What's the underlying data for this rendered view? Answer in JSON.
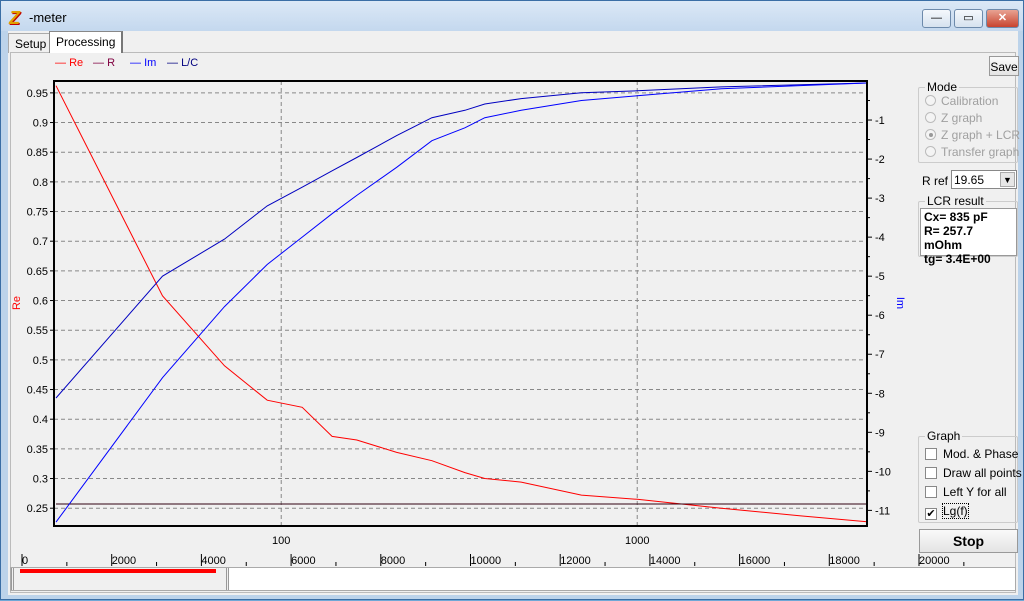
{
  "window": {
    "title": "-meter",
    "logo": "Z",
    "minimize": "—",
    "maximize": "▭",
    "close": "✕"
  },
  "tabs": [
    {
      "label": "Setup"
    },
    {
      "label": "Processing"
    }
  ],
  "legend": [
    {
      "label": "Re",
      "color": "#ff0000"
    },
    {
      "label": "R",
      "color": "#800040"
    },
    {
      "label": "Im",
      "color": "#0000ff"
    },
    {
      "label": "L/C",
      "color": "#000080"
    }
  ],
  "save_label": "Save",
  "mode": {
    "title": "Mode",
    "options": [
      {
        "label": "Calibration",
        "selected": false
      },
      {
        "label": "Z graph",
        "selected": false
      },
      {
        "label": "Z graph + LCR",
        "selected": true
      },
      {
        "label": "Transfer graph",
        "selected": false
      }
    ]
  },
  "rref": {
    "label": "R ref",
    "value": "19.65"
  },
  "lcr": {
    "title": "LCR result",
    "lines": [
      "Cx= 835 pF",
      "R= 257.7 mOhm",
      "tg= 3.4E+00"
    ]
  },
  "graph": {
    "title": "Graph",
    "options": [
      {
        "label": "Mod. & Phase",
        "checked": false
      },
      {
        "label": "Draw all points",
        "checked": false
      },
      {
        "label": "Left Y for all",
        "checked": false
      },
      {
        "label": "Lg(f)",
        "checked": true
      }
    ]
  },
  "stop_label": "Stop",
  "ruler": {
    "ticks": [
      "0",
      "2000",
      "4000",
      "6000",
      "8000",
      "10000",
      "12000",
      "14000",
      "16000",
      "18000",
      "20000"
    ],
    "range_selected": [
      0,
      4300
    ]
  },
  "chart_data": {
    "type": "line",
    "xscale": "log",
    "xlim": [
      23,
      4420
    ],
    "x_ticks": [
      "100",
      "1000"
    ],
    "x_tick_values": [
      100,
      1000
    ],
    "ylabel": "Re",
    "ylim": [
      0.22,
      0.97
    ],
    "y_ticks": [
      "0.95",
      "0.9",
      "0.85",
      "0.8",
      "0.75",
      "0.7",
      "0.65",
      "0.6",
      "0.55",
      "0.5",
      "0.45",
      "0.4",
      "0.35",
      "0.3",
      "0.25"
    ],
    "y2label": "Im",
    "y2lim": [
      -11.4,
      0
    ],
    "y2_ticks": [
      "-1",
      "-2",
      "-3",
      "-4",
      "-5",
      "-6",
      "-7",
      "-8",
      "-9",
      "-10",
      "-11"
    ],
    "grid": true,
    "series": [
      {
        "name": "Re",
        "axis": "left",
        "color": "#ff0000",
        "x": [
          23.3,
          46.4,
          69.3,
          91.3,
          114.5,
          139,
          163,
          211,
          265,
          328,
          373,
          472,
          697,
          1000,
          1722,
          2880,
          4420
        ],
        "y": [
          0.962,
          0.608,
          0.49,
          0.432,
          0.42,
          0.371,
          0.365,
          0.344,
          0.33,
          0.31,
          0.3,
          0.294,
          0.272,
          0.265,
          0.25,
          0.237,
          0.227
        ]
      },
      {
        "name": "R",
        "axis": "left",
        "color": "#300010",
        "x": [
          23.3,
          4420
        ],
        "y": [
          0.257,
          0.257
        ]
      },
      {
        "name": "L/C",
        "axis": "right",
        "color": "#0000c0",
        "x": [
          23.3,
          46.4,
          69.3,
          91.3,
          114.5,
          139,
          163,
          211,
          265,
          328,
          373,
          472,
          697,
          1000,
          1722,
          4420
        ],
        "y": [
          -8.12,
          -5.0,
          -4.05,
          -3.2,
          -2.72,
          -2.3,
          -1.96,
          -1.4,
          -0.94,
          -0.75,
          -0.59,
          -0.45,
          -0.3,
          -0.25,
          -0.15,
          -0.05
        ]
      },
      {
        "name": "Im",
        "axis": "right",
        "color": "#0000ff",
        "x": [
          23.3,
          46.4,
          69.3,
          91.3,
          114.5,
          139,
          163,
          211,
          265,
          328,
          373,
          472,
          697,
          1000,
          1722,
          4420
        ],
        "y": [
          -11.3,
          -7.6,
          -5.78,
          -4.7,
          -4.0,
          -3.4,
          -2.93,
          -2.21,
          -1.53,
          -1.2,
          -0.94,
          -0.75,
          -0.5,
          -0.38,
          -0.2,
          -0.05
        ]
      }
    ]
  }
}
